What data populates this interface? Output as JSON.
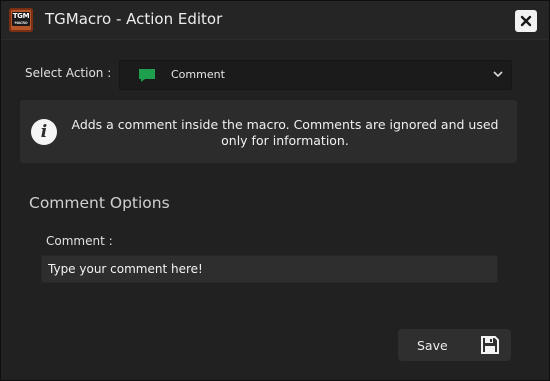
{
  "window": {
    "title": "TGMacro - Action Editor",
    "logo_text": "TGM",
    "logo_subtext": "MACRO"
  },
  "select_action": {
    "label": "Select Action :",
    "value": "Comment",
    "icon": "comment-icon"
  },
  "info": {
    "icon": "info-icon",
    "text": "Adds a comment inside the macro. Comments are ignored and used only for information."
  },
  "comment_options": {
    "title": "Comment Options",
    "comment_label": "Comment :",
    "comment_value": "Type your comment here!"
  },
  "footer": {
    "save_label": "Save",
    "save_icon": "floppy-disk-icon"
  },
  "colors": {
    "window_bg": "#212121",
    "titlebar_bg": "#252525",
    "panel_bg": "#2c2c2c",
    "accent_green": "#1e9f4d",
    "logo_orange": "#b5562a"
  }
}
